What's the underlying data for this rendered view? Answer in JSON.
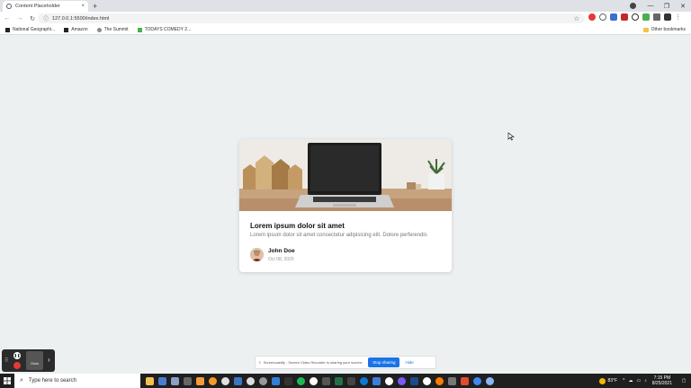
{
  "browser": {
    "tab_title": "Content Placeholder",
    "tab_close": "×",
    "new_tab": "+",
    "url": "127.0.0.1:5500/index.html",
    "window_controls": [
      "⌄",
      "—",
      "❐",
      "✕"
    ]
  },
  "bookmarks": {
    "items": [
      "National Geographi...",
      "Amazon",
      "The Summit",
      "TODAYS COMEDY 2..."
    ],
    "other": "Other bookmarks"
  },
  "card": {
    "title": "Lorem ipsum dolor sit amet",
    "description": "Lorem ipsum dolor sit amet consectetur adipisicing elit. Dolore perferendis",
    "author_name": "John Doe",
    "author_date": "Oct 08, 2020"
  },
  "recorder": {
    "clicks_label": "Clicks"
  },
  "sharebar": {
    "message": "Screencastify - Screen Video Recorder is sharing your screen.",
    "stop_label": "Stop sharing",
    "hide_label": "Hide"
  },
  "taskbar": {
    "search_placeholder": "Type here to search",
    "weather": "83°F",
    "time": "7:15 PM",
    "date": "8/25/2021"
  },
  "colors": {
    "page_bg": "#ecf0f1",
    "accent": "#1a73e8",
    "record_red": "#e53935"
  }
}
